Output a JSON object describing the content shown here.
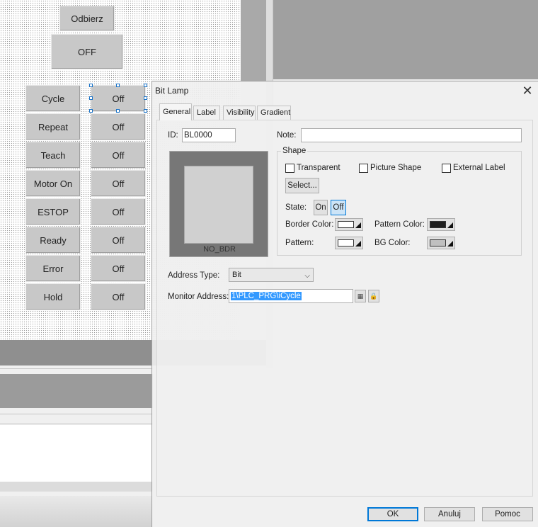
{
  "canvas": {
    "top_buttons": [
      "Odbierz",
      "OFF"
    ],
    "left_buttons": [
      "Cycle",
      "Repeat",
      "Teach",
      "Motor On",
      "ESTOP",
      "Ready",
      "Error",
      "Hold"
    ],
    "lamp_values": [
      "Off",
      "Off",
      "Off",
      "Off",
      "Off",
      "Off",
      "Off",
      "Off"
    ]
  },
  "dialog": {
    "title": "Bit Lamp",
    "tabs": [
      "General",
      "Label",
      "Visibility",
      "Gradient"
    ],
    "active_tab": "General",
    "id_label": "ID:",
    "id_value": "BL0000",
    "note_label": "Note:",
    "note_value": "",
    "preview_caption": "NO_BDR",
    "shape_group_label": "Shape",
    "checkboxes": {
      "transparent": "Transparent",
      "picture_shape": "Picture Shape",
      "external_label": "External Label"
    },
    "select_button": "Select...",
    "state_label": "State:",
    "state_on": "On",
    "state_off": "Off",
    "border_color_label": "Border Color:",
    "pattern_color_label": "Pattern Color:",
    "pattern_label": "Pattern:",
    "bg_color_label": "BG Color:",
    "colors": {
      "border_color": "#ffffff",
      "pattern_color": "#1e1e1e",
      "pattern": "#ffffff",
      "bg_color": "#c0c0c0"
    },
    "address_type_label": "Address Type:",
    "address_type_value": "Bit",
    "monitor_address_label": "Monitor Address:",
    "monitor_address_value": "1\\PLC_PRG\\iCycle",
    "buttons": {
      "ok": "OK",
      "cancel": "Anuluj",
      "help": "Pomoc"
    }
  }
}
